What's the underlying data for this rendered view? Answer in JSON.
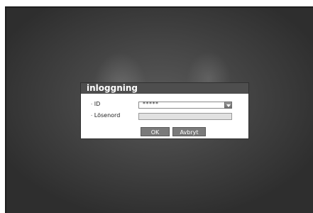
{
  "dialog": {
    "title": "inloggning",
    "id_label": "ID",
    "id_value": "*****",
    "password_label": "Lösenord",
    "password_value": "",
    "ok_label": "OK",
    "cancel_label": "Avbryt"
  },
  "colors": {
    "title_bar": "#4e4e4e",
    "button": "#7a7a7a",
    "background": "#3f3f3f"
  },
  "icons": {
    "dropdown": "chevron-down-icon"
  }
}
